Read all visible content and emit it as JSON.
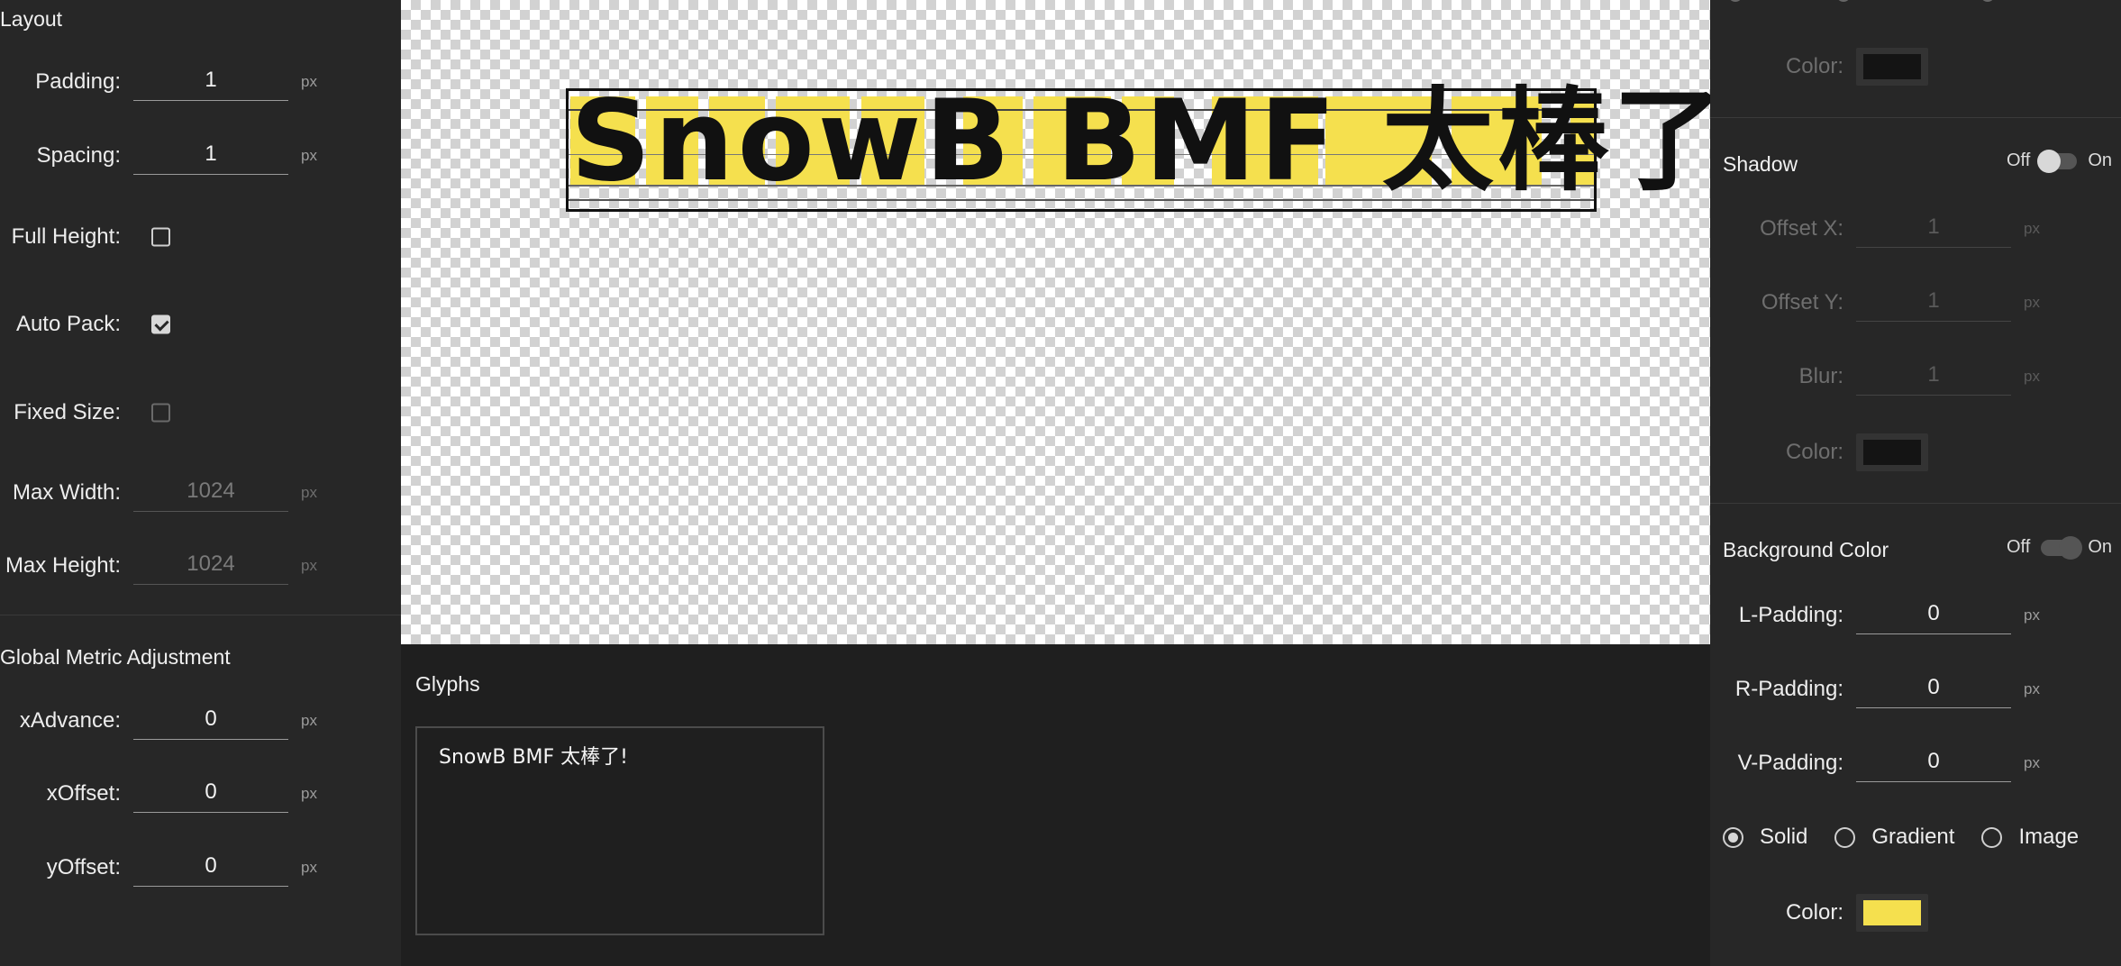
{
  "layout": {
    "title": "Layout",
    "padding": {
      "label": "Padding:",
      "value": "1",
      "unit": "px"
    },
    "spacing": {
      "label": "Spacing:",
      "value": "1",
      "unit": "px"
    },
    "full_height": {
      "label": "Full Height:",
      "checked": false
    },
    "auto_pack": {
      "label": "Auto Pack:",
      "checked": true
    },
    "fixed_size": {
      "label": "Fixed Size:",
      "checked": false
    },
    "max_width": {
      "label": "Max Width:",
      "value": "1024",
      "unit": "px"
    },
    "max_height": {
      "label": "Max Height:",
      "value": "1024",
      "unit": "px"
    }
  },
  "metric": {
    "title": "Global Metric Adjustment",
    "x_advance": {
      "label": "xAdvance:",
      "value": "0",
      "unit": "px"
    },
    "x_offset": {
      "label": "xOffset:",
      "value": "0",
      "unit": "px"
    },
    "y_offset": {
      "label": "yOffset:",
      "value": "0",
      "unit": "px"
    }
  },
  "preview": {
    "text": "SnowB BMF 太棒了!"
  },
  "glyphs": {
    "title": "Glyphs",
    "text": "SnowB BMF 太棒了! "
  },
  "stroke": {
    "color_label": "Color:",
    "color": "#141414"
  },
  "shadow": {
    "title": "Shadow",
    "off": "Off",
    "on": "On",
    "offset_x": {
      "label": "Offset X:",
      "value": "1",
      "unit": "px"
    },
    "offset_y": {
      "label": "Offset Y:",
      "value": "1",
      "unit": "px"
    },
    "blur": {
      "label": "Blur:",
      "value": "1",
      "unit": "px"
    },
    "color_label": "Color:",
    "color": "#141414"
  },
  "background": {
    "title": "Background Color",
    "off": "Off",
    "on": "On",
    "l_padding": {
      "label": "L-Padding:",
      "value": "0",
      "unit": "px"
    },
    "r_padding": {
      "label": "R-Padding:",
      "value": "0",
      "unit": "px"
    },
    "v_padding": {
      "label": "V-Padding:",
      "value": "0",
      "unit": "px"
    },
    "fill_types": [
      "Solid",
      "Gradient",
      "Image"
    ],
    "selected_fill": "Solid",
    "color_label": "Color:",
    "color": "#f5e04e"
  }
}
